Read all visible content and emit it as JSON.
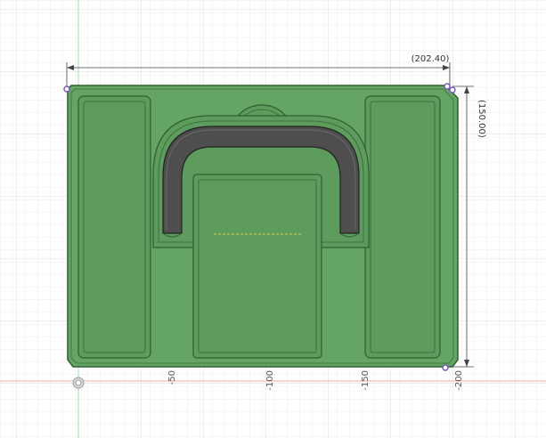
{
  "dimensions": {
    "width_label": "(202.40)",
    "height_label": "(150.00)"
  },
  "axis_ticks": [
    "-50",
    "-100",
    "-150",
    "-200"
  ],
  "colors": {
    "background": "#ffffff",
    "grid_minor": "#ececec",
    "grid_major": "#dedede",
    "axis_vertical": "#9fd79f",
    "axis_horizontal": "#f2a0a0",
    "body_fill": "#64a564",
    "body_edge": "#2e5f2e",
    "pocket_fill": "#5d9c5d",
    "handle_fill": "#4e4e4e",
    "handle_edge": "#222222",
    "dimension_line": "#444444",
    "vertex_marker": "#7a55c8"
  },
  "icons": {
    "origin": "origin-marker-icon"
  }
}
